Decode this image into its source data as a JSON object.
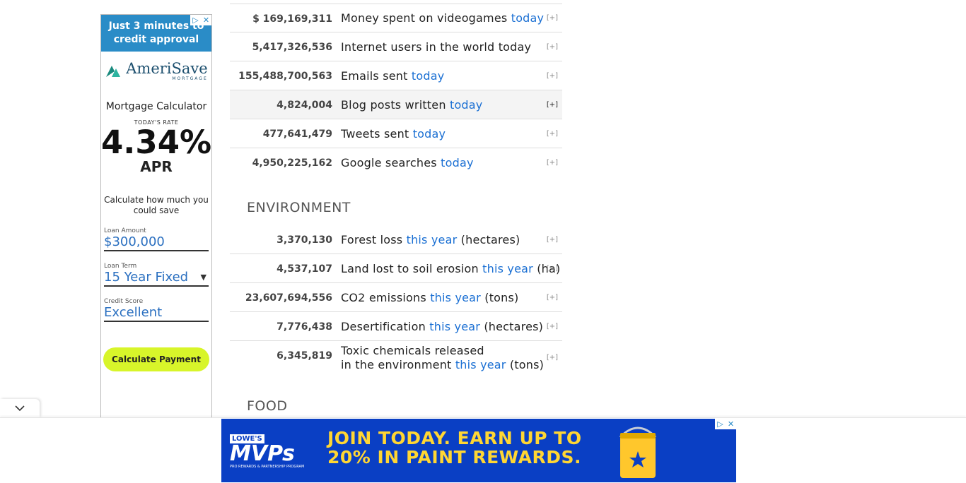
{
  "side_ad": {
    "promo": "Just 3 minutes to credit approval",
    "brand": "AmeriSave",
    "brand_sub": "MORTGAGE",
    "calculator_title": "Mortgage Calculator",
    "rate_label": "TODAY'S RATE",
    "rate": "4.34%",
    "apr": "APR",
    "save_text": "Calculate how much you could save",
    "loan_amount_label": "Loan Amount",
    "loan_amount_value": "$300,000",
    "loan_term_label": "Loan Term",
    "loan_term_value": "15 Year Fixed",
    "credit_label": "Credit Score",
    "credit_value": "Excellent",
    "cta": "Calculate Payment"
  },
  "rows_top": [
    {
      "num": "$ 169,169,311",
      "text": "Money spent on videogames",
      "hl": "today",
      "after": "",
      "plus": "[+]"
    },
    {
      "num": "5,417,326,536",
      "text": "Internet users in the world today",
      "hl": "",
      "after": "",
      "plus": "[+]"
    },
    {
      "num": "155,488,700,563",
      "text": "Emails sent",
      "hl": "today",
      "after": "",
      "plus": "[+]"
    },
    {
      "num": "4,824,004",
      "text": "Blog posts written",
      "hl": "today",
      "after": "",
      "plus": "[+]"
    },
    {
      "num": "477,641,479",
      "text": "Tweets sent",
      "hl": "today",
      "after": "",
      "plus": "[+]"
    },
    {
      "num": "4,950,225,162",
      "text": "Google searches",
      "hl": "today",
      "after": "",
      "plus": "[+]"
    }
  ],
  "environment": {
    "title": "ENVIRONMENT",
    "rows": [
      {
        "num": "3,370,130",
        "text": "Forest loss",
        "hl": "this year",
        "after": "(hectares)",
        "plus": "[+]"
      },
      {
        "num": "4,537,107",
        "text": "Land lost to soil erosion",
        "hl": "this year",
        "after": "(ha)",
        "plus": "[+]"
      },
      {
        "num": "23,607,694,556",
        "text": "CO2 emissions",
        "hl": "this year",
        "after": "(tons)",
        "plus": "[+]"
      },
      {
        "num": "7,776,438",
        "text": "Desertification",
        "hl": "this year",
        "after": "(hectares)",
        "plus": "[+]"
      }
    ],
    "toxic": {
      "num": "6,345,819",
      "line1": "Toxic chemicals released",
      "line2": "in the environment",
      "hl": "this year",
      "after": "(tons)",
      "plus": "[+]"
    }
  },
  "food": {
    "title": "FOOD"
  },
  "banner": {
    "badge": "LOWE'S",
    "brand": "MVPs",
    "brand_sub": "PRO REWARDS & PARTNERSHIP PROGRAM",
    "line1": "JOIN TODAY. EARN UP TO",
    "line2": "20% IN PAINT REWARDS."
  },
  "colors": {
    "link": "#1a6fd3",
    "banner_bg": "#0a3fc4",
    "banner_text": "#ffd633",
    "cta": "#d8f52a"
  }
}
